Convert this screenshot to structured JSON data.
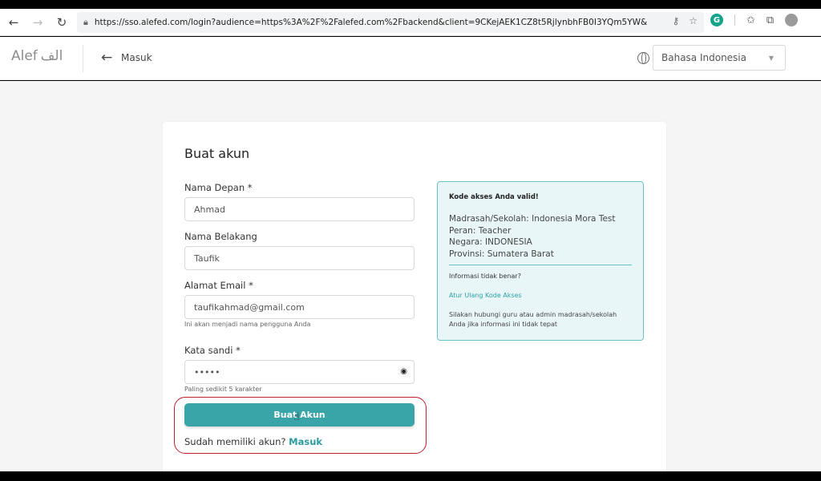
{
  "browser": {
    "url": "https://sso.alefed.com/login?audience=https%3A%2F%2Falefed.com%2Fbackend&client=9CKejAEK1CZ8t5RjlynbhFB0I3YQm5YW&protocol=oauth2&redirect_uri=...",
    "extension_letter": "G"
  },
  "header": {
    "logo_latin": "Alef",
    "logo_arabic": "الف",
    "back_label": "Masuk",
    "language": "Bahasa Indonesia"
  },
  "form": {
    "title": "Buat akun",
    "first_name_label": "Nama Depan *",
    "first_name_value": "Ahmad",
    "last_name_label": "Nama Belakang",
    "last_name_value": "Taufik",
    "email_label": "Alamat Email *",
    "email_value": "taufikahmad@gmail.com",
    "email_hint": "Ini akan menjadi nama pengguna Anda",
    "password_label": "Kata sandi *",
    "password_value": "•••••",
    "password_hint": "Paling sedikit 5 karakter",
    "submit_label": "Buat Akun",
    "has_account_text": "Sudah memiliki akun?",
    "login_link": "Masuk"
  },
  "info": {
    "heading": "Kode akses Anda valid!",
    "school": "Madrasah/Sekolah: Indonesia Mora Test",
    "role": "Peran: Teacher",
    "country": "Negara: INDONESIA",
    "province": "Provinsi: Sumatera Barat",
    "question": "Informasi tidak benar?",
    "reset_link": "Atur Ulang Kode Akses",
    "note": "Silakan hubungi guru atau admin madrasah/sekolah Anda jika informasi ini tidak tepat"
  },
  "colors": {
    "accent": "#3aa5a8",
    "highlight": "#c41e2a",
    "info_bg": "#e9f6f7"
  }
}
